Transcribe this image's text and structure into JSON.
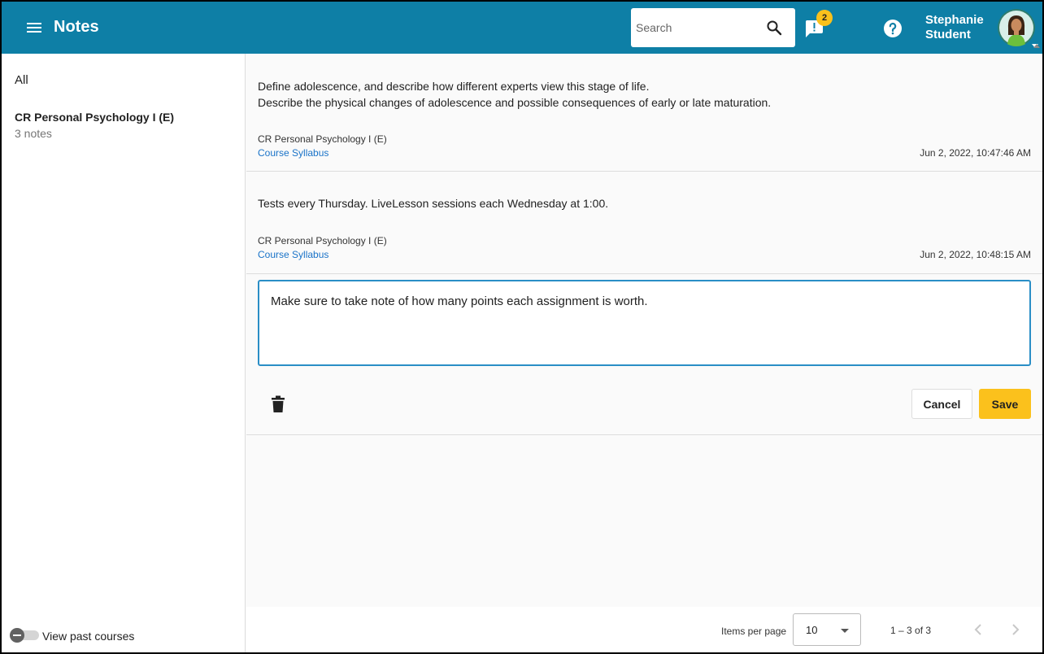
{
  "header": {
    "title": "Notes",
    "search_placeholder": "Search",
    "alert_count": "2",
    "user_name": "Stephanie Student"
  },
  "sidebar": {
    "all_label": "All",
    "course_title": "CR Personal Psychology I (E)",
    "course_count": "3 notes",
    "past_courses_label": "View past courses"
  },
  "notes": [
    {
      "line1": "Define adolescence, and describe how different experts view this stage of life.",
      "line2": "Describe the physical changes of adolescence and possible consequences of early or late maturation.",
      "course": "CR Personal Psychology I (E)",
      "link": "Course Syllabus",
      "timestamp": "Jun 2, 2022, 10:47:46 AM"
    },
    {
      "line1": "Tests every Thursday. LiveLesson sessions each Wednesday at 1:00.",
      "course": "CR Personal Psychology I (E)",
      "link": "Course Syllabus",
      "timestamp": "Jun 2, 2022, 10:48:15 AM"
    }
  ],
  "editor": {
    "value": "Make sure to take note of how many points each assignment is worth.",
    "cancel_label": "Cancel",
    "save_label": "Save"
  },
  "pager": {
    "items_per_page_label": "Items per page",
    "items_per_page_value": "10",
    "range": "1 – 3 of 3"
  },
  "colors": {
    "header_bg": "#0e7fa6",
    "accent_yellow": "#fbc11c",
    "link_blue": "#1a73c8",
    "focus_border": "#2a8ec6"
  },
  "icons": [
    "menu-icon",
    "search-icon",
    "alert-icon",
    "help-icon",
    "trash-icon",
    "chevron-left-icon",
    "chevron-right-icon"
  ]
}
